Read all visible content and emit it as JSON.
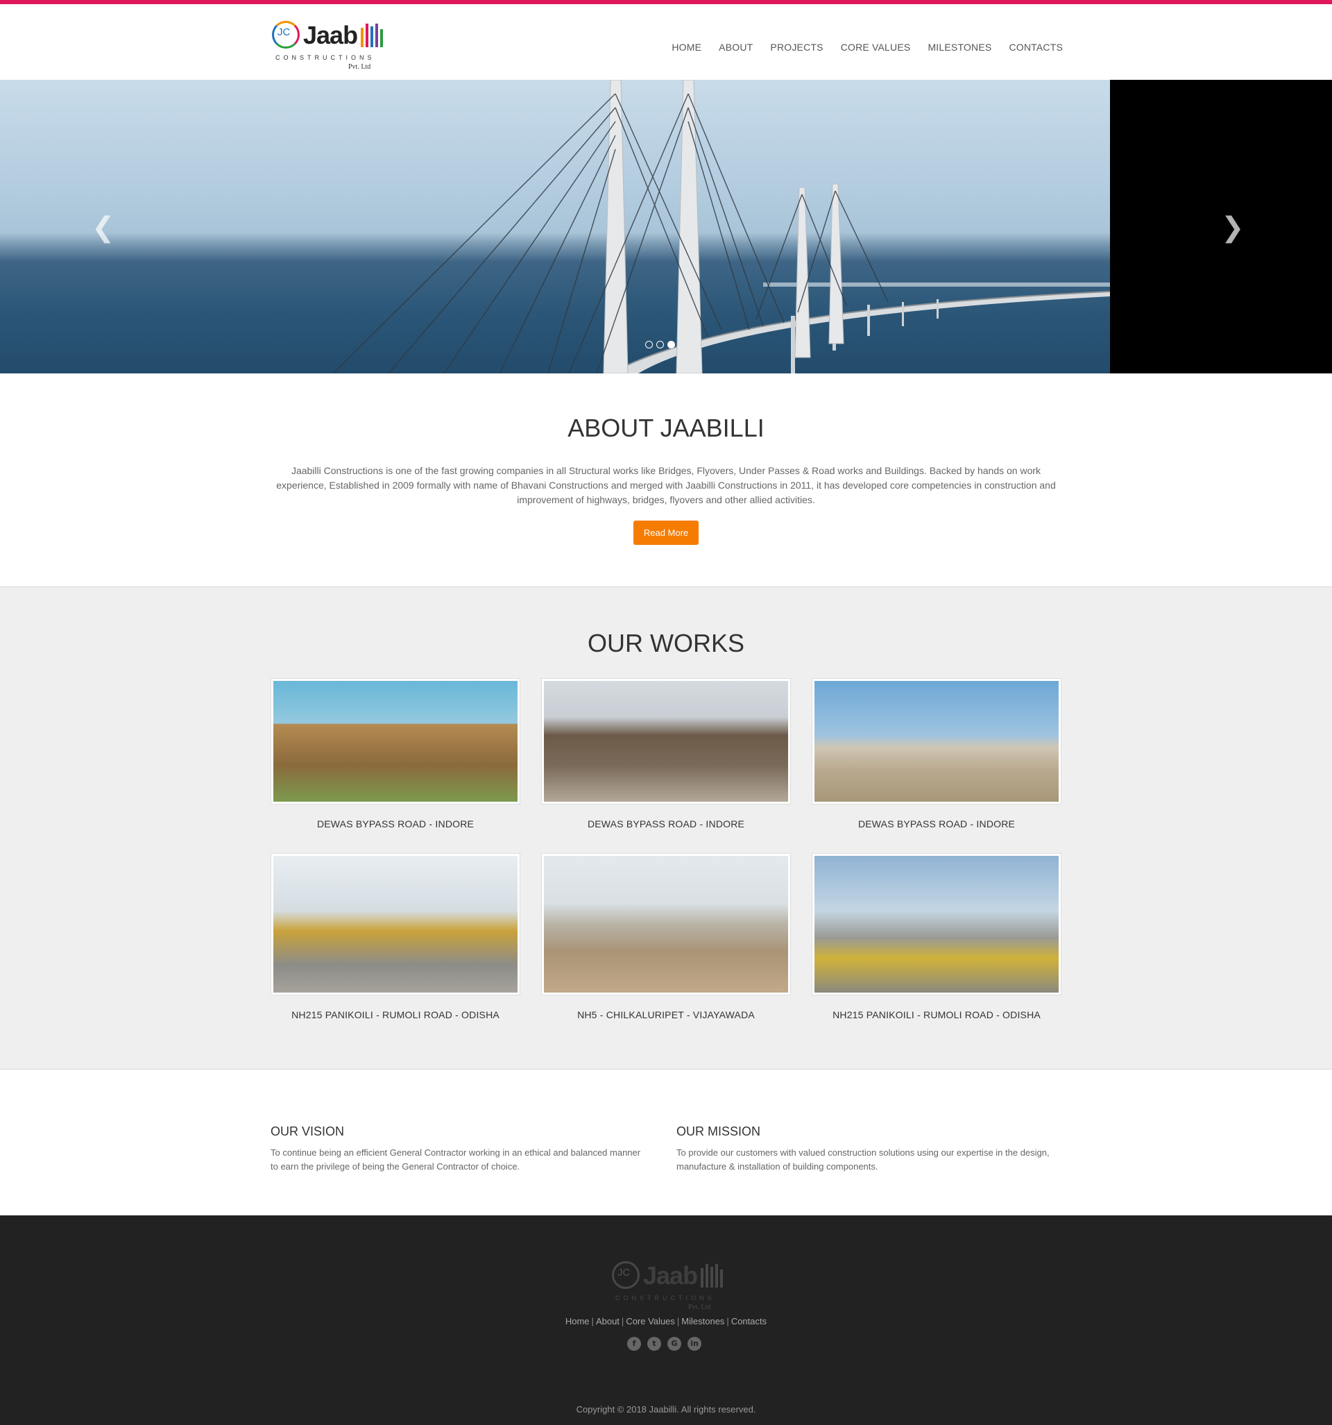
{
  "brand": {
    "logo_initials": "JC",
    "logo_word": "Jaab",
    "logo_sub": "CONSTRUCTIONS",
    "logo_pvt": "Pvt. Ltd"
  },
  "nav": {
    "items": [
      "HOME",
      "ABOUT",
      "PROJECTS",
      "CORE VALUES",
      "MILESTONES",
      "CONTACTS"
    ]
  },
  "hero": {
    "prev_icon": "chevron-left-icon",
    "next_icon": "chevron-right-icon",
    "slides_count": 3,
    "active_slide": 3
  },
  "about": {
    "title": "ABOUT JAABILLI",
    "text": "Jaabilli Constructions is one of the fast growing companies in all Structural works like Bridges, Flyovers, Under Passes & Road works and Buildings. Backed by hands on work experience, Established in 2009 formally with name of Bhavani Constructions and merged with Jaabilli Constructions in 2011, it has developed core competencies in construction and improvement of highways, bridges, flyovers and other allied activities.",
    "button": "Read More"
  },
  "works": {
    "title": "OUR WORKS",
    "items": [
      {
        "caption": "DEWAS BYPASS ROAD - INDORE"
      },
      {
        "caption": "DEWAS BYPASS ROAD - INDORE"
      },
      {
        "caption": "DEWAS BYPASS ROAD - INDORE"
      },
      {
        "caption": "NH215 PANIKOILI - RUMOLI ROAD - ODISHA"
      },
      {
        "caption": "NH5 - CHILKALURIPET - VIJAYAWADA"
      },
      {
        "caption": "NH215 PANIKOILI - RUMOLI ROAD - ODISHA"
      }
    ]
  },
  "vision": {
    "title": "OUR VISION",
    "text": "To continue being an efficient General Contractor working in an ethical and balanced manner to earn the privilege of being the General Contractor of choice."
  },
  "mission": {
    "title": "OUR MISSION",
    "text": "To provide our customers with valued construction solutions using our expertise in the design, manufacture & installation of building components."
  },
  "footer": {
    "links": [
      "Home",
      "About",
      "Core Values",
      "Milestones",
      "Contacts"
    ],
    "social": [
      "facebook-icon",
      "twitter-icon",
      "google-plus-icon",
      "linkedin-icon"
    ],
    "copyright": "Copyright © 2018 Jaabilli. All rights reserved."
  },
  "colors": {
    "accent_bar": "#e0175a",
    "button": "#f57c00",
    "footer_bg": "#222222",
    "works_bg": "#efefef"
  }
}
